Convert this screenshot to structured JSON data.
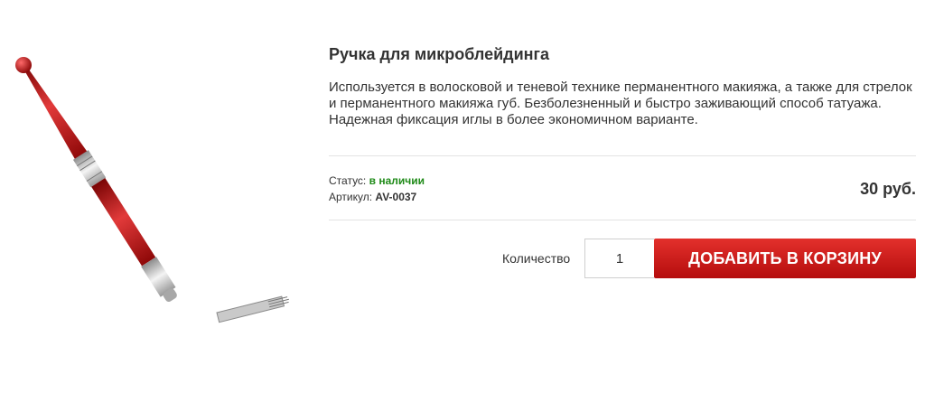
{
  "product": {
    "title": "Ручка для микроблейдинга",
    "description": "Используется в волосковой и теневой технике перманентного макияжа, а также для стрелок и перманентного макияжа губ. Безболезненный и быстро заживающий способ татуажа. Надежная фиксация иглы в более экономичном варианте.",
    "image_icon": "microblading-pen",
    "status_label": "Статус:",
    "status_value": "в наличии",
    "sku_label": "Артикул:",
    "sku_value": "AV-0037",
    "price": "30 руб."
  },
  "cart": {
    "quantity_label": "Количество",
    "quantity_value": "1",
    "add_button_label": "ДОБАВИТЬ В КОРЗИНУ"
  },
  "colors": {
    "accent": "#d01f1f",
    "in_stock": "#1e8a17"
  }
}
